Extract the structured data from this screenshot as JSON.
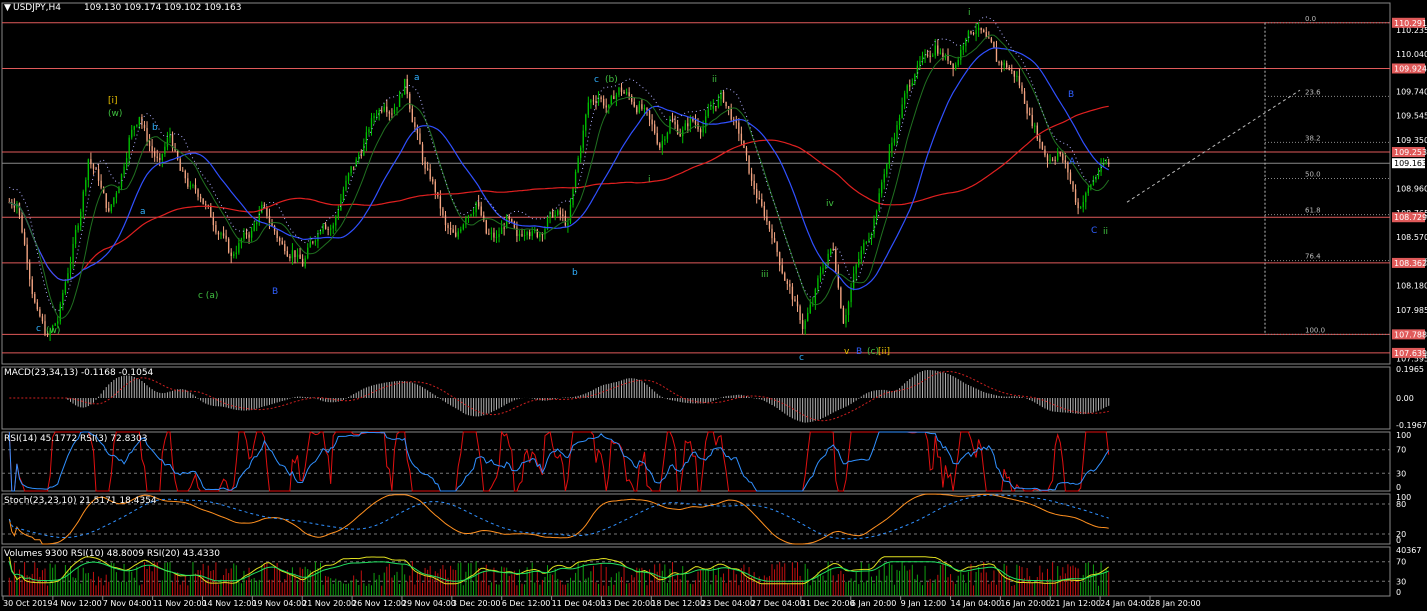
{
  "header": {
    "symbol": "USDJPY,H4",
    "ohlc": "109.130 109.174 109.102 109.163"
  },
  "colors": {
    "bull": "#00c000",
    "bear": "#f4a582",
    "ma_red": "#e02020",
    "ma_blue": "#3050ff",
    "level_line": "#e05a5a",
    "price_box": "#e05a5a"
  },
  "chart_data": [
    {
      "type": "candlestick",
      "title": "USDJPY,H4",
      "price_labels": [
        "110.235",
        "110.040",
        "109.740",
        "109.545",
        "109.350",
        "108.960",
        "108.765",
        "108.570",
        "108.375",
        "108.180",
        "107.985",
        "107.595"
      ],
      "highlighted_levels": [
        "110.291",
        "109.924",
        "109.253",
        "108.729",
        "108.362",
        "107.788",
        "107.639"
      ],
      "current_price": "109.163",
      "ylim": [
        107.55,
        110.45
      ],
      "fibonacci": [
        {
          "ratio": "0.0",
          "price": 110.291
        },
        {
          "ratio": "23.6",
          "price": 109.7
        },
        {
          "ratio": "38.2",
          "price": 109.33
        },
        {
          "ratio": "50.0",
          "price": 109.04
        },
        {
          "ratio": "61.8",
          "price": 108.75
        },
        {
          "ratio": "76.4",
          "price": 108.38
        },
        {
          "ratio": "100.0",
          "price": 107.788
        }
      ],
      "close_path": [
        108.85,
        108.4,
        107.95,
        107.75,
        107.9,
        108.3,
        108.7,
        109.2,
        109.05,
        108.75,
        109.0,
        109.35,
        109.55,
        109.3,
        109.15,
        109.4,
        109.1,
        108.95,
        108.9,
        108.75,
        108.6,
        108.4,
        108.55,
        108.6,
        108.8,
        108.65,
        108.5,
        108.45,
        108.35,
        108.55,
        108.7,
        108.65,
        108.95,
        109.15,
        109.3,
        109.55,
        109.65,
        109.6,
        109.8,
        109.45,
        109.1,
        108.95,
        108.65,
        108.55,
        108.75,
        108.85,
        108.6,
        108.55,
        108.7,
        108.55,
        108.65,
        108.6,
        108.7,
        108.75,
        108.65,
        109.2,
        109.65,
        109.7,
        109.6,
        109.75,
        109.7,
        109.6,
        109.5,
        109.3,
        109.5,
        109.4,
        109.5,
        109.45,
        109.6,
        109.7,
        109.55,
        109.35,
        109.0,
        108.8,
        108.6,
        108.3,
        108.1,
        107.85,
        108.05,
        108.35,
        108.5,
        107.9,
        108.25,
        108.5,
        108.7,
        109.1,
        109.4,
        109.7,
        109.9,
        110.0,
        110.1,
        110.0,
        109.95,
        110.2,
        110.25,
        110.15,
        110.0,
        109.95,
        109.85,
        109.6,
        109.4,
        109.2,
        109.25,
        109.1,
        108.8,
        108.95,
        109.1,
        109.16
      ]
    },
    {
      "type": "histogram",
      "title": "MACD(23,34,13) -0.1168 -0.1054",
      "tick_labels": [
        "0.1965",
        "0.00",
        "-0.1967"
      ]
    },
    {
      "type": "line",
      "title": "RSI(14) 45.1772  RSI(3) 72.8303",
      "tick_labels": [
        "100",
        "70",
        "30",
        "0"
      ]
    },
    {
      "type": "line",
      "title": "Stoch(23,23,10) 21.5171 18.4354",
      "tick_labels": [
        "100",
        "80",
        "20",
        "0"
      ]
    },
    {
      "type": "bar",
      "title": "Volumes 9300  RSI(10) 48.8009  RSI(20) 43.4330",
      "tick_labels": [
        "40367",
        "70",
        "30",
        "0"
      ]
    }
  ],
  "time_axis": [
    "30 Oct 2019",
    "4 Nov 12:00",
    "7 Nov 04:00",
    "11 Nov 20:00",
    "14 Nov 12:00",
    "19 Nov 04:00",
    "21 Nov 20:00",
    "26 Nov 12:00",
    "29 Nov 04:00",
    "3 Dec 20:00",
    "6 Dec 12:00",
    "11 Dec 04:00",
    "13 Dec 20:00",
    "18 Dec 12:00",
    "23 Dec 04:00",
    "27 Dec 04:00",
    "31 Dec 20:00",
    "6 Jan 20:00",
    "9 Jan 12:00",
    "14 Jan 04:00",
    "16 Jan 20:00",
    "21 Jan 12:00",
    "24 Jan 04:00",
    "28 Jan 20:00"
  ],
  "wave_labels": [
    {
      "text": "[i]",
      "color": "#e8c000"
    },
    {
      "text": "(w)",
      "color": "#40c040"
    },
    {
      "text": "b",
      "color": "#30b0ff"
    },
    {
      "text": "a",
      "color": "#30b0ff"
    },
    {
      "text": "c (a)",
      "color": "#40c040"
    },
    {
      "text": "B",
      "color": "#3060ff"
    },
    {
      "text": "c",
      "color": "#30b0ff"
    },
    {
      "text": "(w)",
      "color": "#40c040"
    },
    {
      "text": "a",
      "color": "#30b0ff"
    },
    {
      "text": "b",
      "color": "#30b0ff"
    },
    {
      "text": "c",
      "color": "#30b0ff"
    },
    {
      "text": "(b)",
      "color": "#40c040"
    },
    {
      "text": "ii",
      "color": "#40c040"
    },
    {
      "text": "i",
      "color": "#40c040"
    },
    {
      "text": "iii",
      "color": "#40c040"
    },
    {
      "text": "iv",
      "color": "#40c040"
    },
    {
      "text": "c",
      "color": "#30b0ff"
    },
    {
      "text": "B",
      "color": "#3060ff"
    },
    {
      "text": "v",
      "color": "#e8c000"
    },
    {
      "text": "(c)",
      "color": "#40c040"
    },
    {
      "text": "[ii]",
      "color": "#e8c000"
    },
    {
      "text": "i",
      "color": "#40c040"
    },
    {
      "text": "A",
      "color": "#3060ff"
    },
    {
      "text": "B",
      "color": "#3060ff"
    },
    {
      "text": "C",
      "color": "#3060ff"
    },
    {
      "text": "ii",
      "color": "#40c040"
    }
  ]
}
